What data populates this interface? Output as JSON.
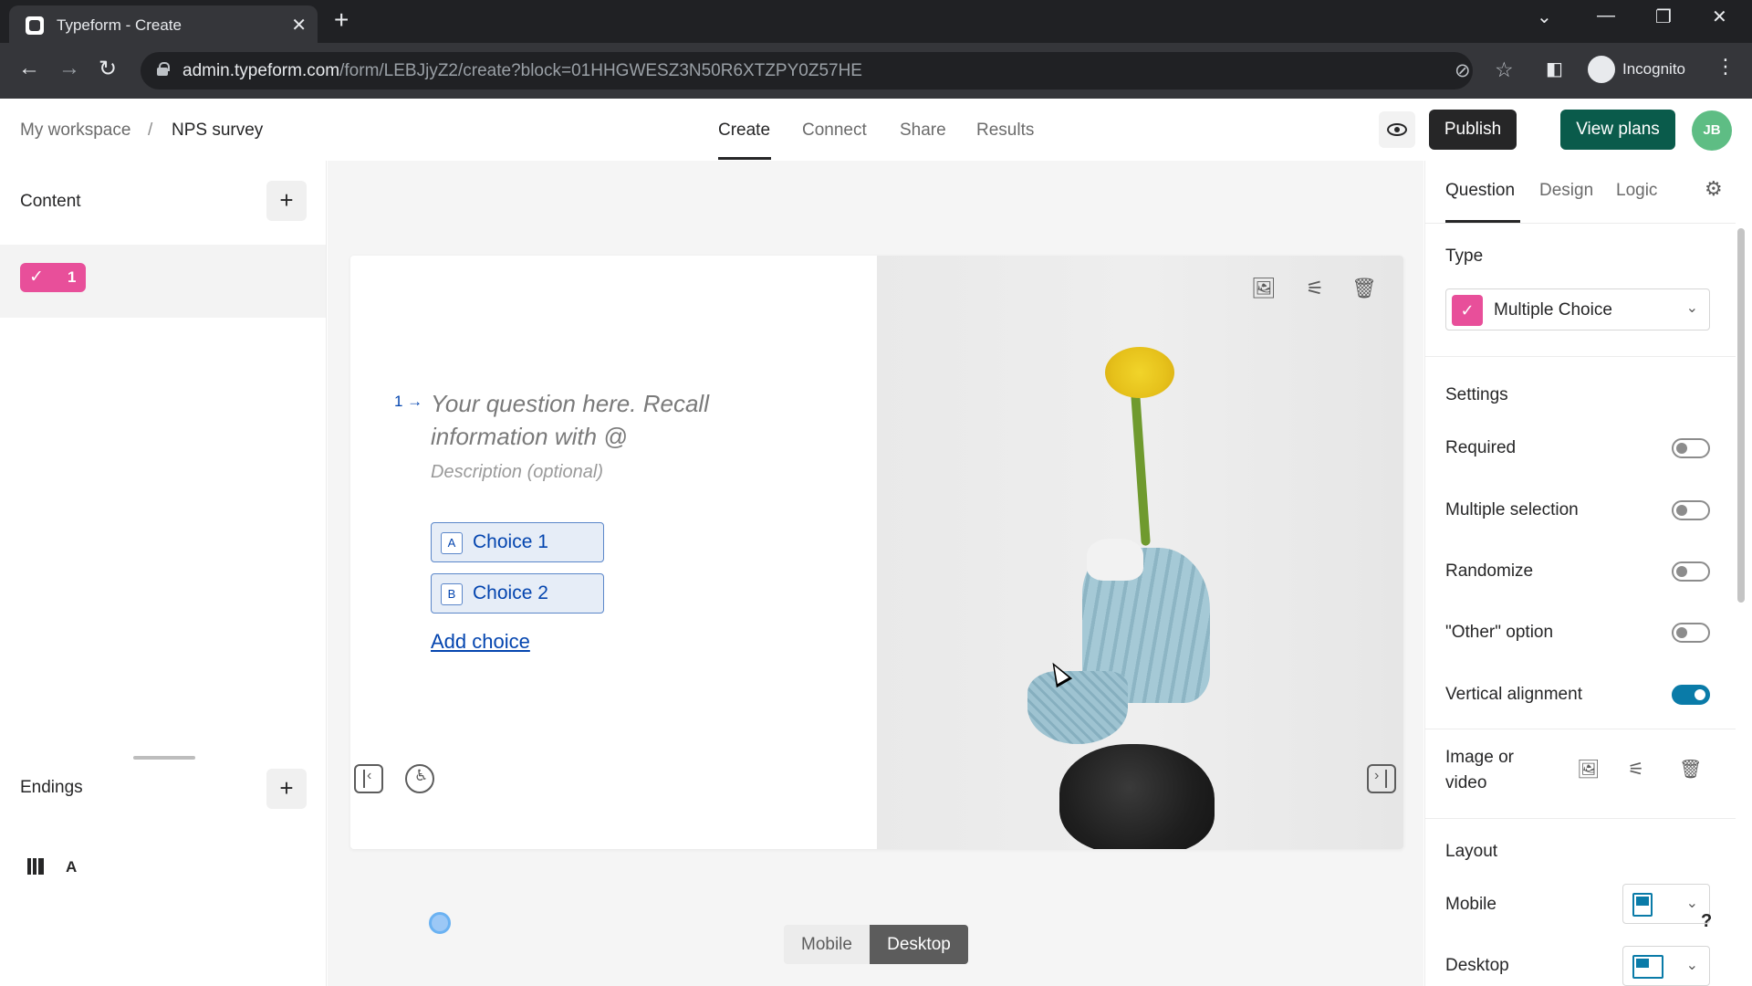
{
  "browser": {
    "tab_title": "Typeform - Create",
    "url_host": "admin.typeform.com",
    "url_path": "/form/LEBJjyZ2/create?block=01HHGWESZ3N50R6XTZPY0Z57HE",
    "profile_label": "Incognito"
  },
  "header": {
    "breadcrumb_workspace": "My workspace",
    "breadcrumb_separator": "/",
    "breadcrumb_form": "NPS survey",
    "tabs": [
      {
        "label": "Create"
      },
      {
        "label": "Connect"
      },
      {
        "label": "Share"
      },
      {
        "label": "Results"
      }
    ],
    "publish_label": "Publish",
    "view_plans_label": "View plans",
    "avatar_initials": "JB"
  },
  "sidebar": {
    "content_label": "Content",
    "question_number": "1",
    "endings_label": "Endings",
    "ending_letter": "A"
  },
  "canvas": {
    "question_marker": "1 →",
    "question_placeholder": "Your question here. Recall information with @",
    "description_placeholder": "Description (optional)",
    "choices": [
      {
        "key": "A",
        "label": "Choice 1"
      },
      {
        "key": "B",
        "label": "Choice 2"
      }
    ],
    "add_choice_label": "Add choice",
    "device_options": [
      "Mobile",
      "Desktop"
    ],
    "active_device": "Desktop"
  },
  "panel": {
    "tabs": [
      {
        "label": "Question"
      },
      {
        "label": "Design"
      },
      {
        "label": "Logic"
      }
    ],
    "type_heading": "Type",
    "type_value": "Multiple Choice",
    "settings_heading": "Settings",
    "settings": [
      {
        "label": "Required",
        "on": false
      },
      {
        "label": "Multiple selection",
        "on": false
      },
      {
        "label": "Randomize",
        "on": false
      },
      {
        "label": "\"Other\" option",
        "on": false
      },
      {
        "label": "Vertical alignment",
        "on": true
      }
    ],
    "image_video_label": "Image or video",
    "layout_heading": "Layout",
    "layout_mobile_label": "Mobile",
    "layout_desktop_label": "Desktop",
    "help_label": "?"
  },
  "colors": {
    "accent_pink": "#e84f9a",
    "publish_bg": "#262627",
    "view_plans_bg": "#0a5b4b",
    "choice_blue": "#0445af",
    "toggle_on": "#0a7ba8"
  }
}
